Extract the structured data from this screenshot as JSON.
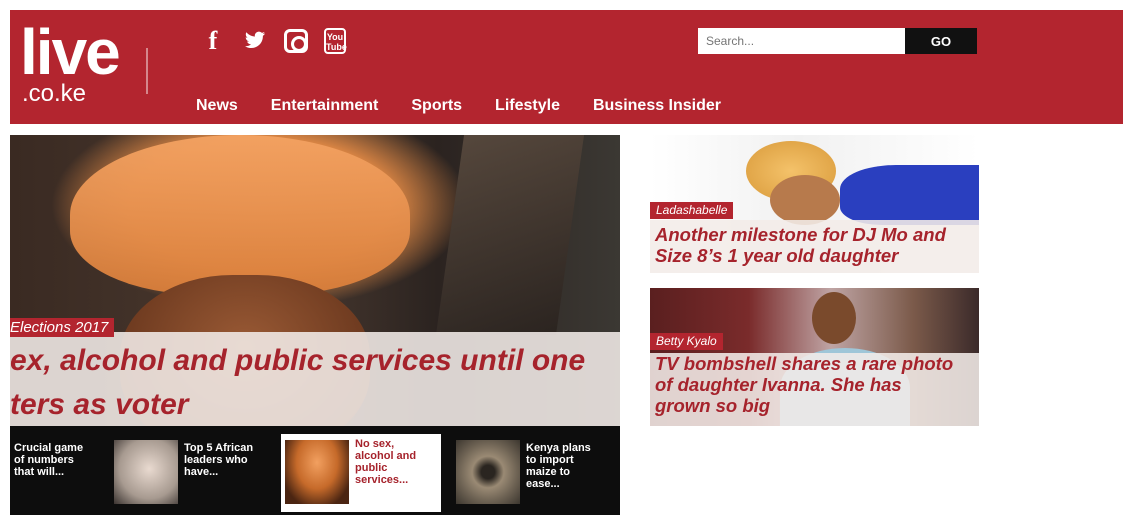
{
  "site": {
    "logo_main": "live",
    "logo_sub": ".co.ke"
  },
  "social": [
    {
      "icon": "facebook-icon",
      "glyph": "f"
    },
    {
      "icon": "twitter-icon",
      "glyph": "🐦"
    },
    {
      "icon": "instagram-icon",
      "glyph": ""
    },
    {
      "icon": "youtube-icon",
      "glyph": "You Tube"
    }
  ],
  "search": {
    "placeholder": "Search...",
    "button_label": "GO"
  },
  "nav": [
    "News",
    "Entertainment",
    "Sports",
    "Lifestyle",
    "Business Insider"
  ],
  "hero": {
    "tag": "Elections 2017",
    "title": "ex, alcohol and public services until one\nters as voter"
  },
  "strip": [
    {
      "text": "Crucial game\nof numbers\nthat will...",
      "has_image": false
    },
    {
      "text": "Top 5 African\nleaders who\nhave...",
      "image": "man-photo"
    },
    {
      "text": "No sex,\nalcohol and\npublic\nservices...",
      "image": "woman-photo",
      "active": true
    },
    {
      "text": "Kenya plans\nto import\nmaize to\nease...",
      "image": "maize-photo"
    }
  ],
  "cards": [
    {
      "tag": "Ladashabelle",
      "title": "Another milestone for DJ Mo and\nSize 8’s 1 year old daughter"
    },
    {
      "tag": "Betty Kyalo",
      "title": "TV bombshell shares a rare photo\nof daughter Ivanna. She has\ngrown so big"
    }
  ],
  "colors": {
    "brand_red": "#b3252f",
    "headline_red": "#a6232c",
    "strip_black": "#0d0d0d"
  }
}
